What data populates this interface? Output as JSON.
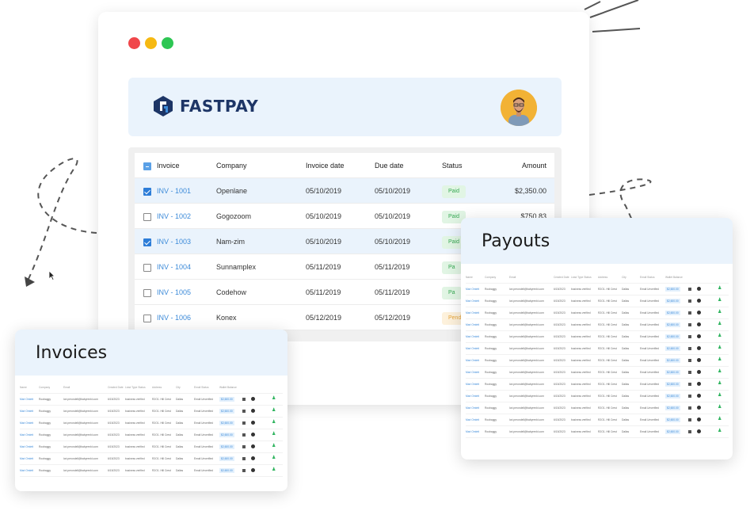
{
  "window": {
    "controls": [
      "close",
      "minimize",
      "maximize"
    ]
  },
  "brand": {
    "name": "FASTPAY",
    "logo_icon": "fastpay-logo-icon",
    "color": "#1d3566"
  },
  "user": {
    "avatar_icon": "user-avatar"
  },
  "invoice_table": {
    "headers": {
      "invoice": "Invoice",
      "company": "Company",
      "invoice_date": "Invoice date",
      "due_date": "Due date",
      "status": "Status",
      "amount": "Amount"
    },
    "rows": [
      {
        "id": "INV - 1001",
        "company": "Openlane",
        "invoice_date": "05/10/2019",
        "due_date": "05/10/2019",
        "status": "Paid",
        "amount": "$2,350.00",
        "checked": true
      },
      {
        "id": "INV - 1002",
        "company": "Gogozoom",
        "invoice_date": "05/10/2019",
        "due_date": "05/10/2019",
        "status": "Paid",
        "amount": "$750.83",
        "checked": false
      },
      {
        "id": "INV - 1003",
        "company": "Nam-zim",
        "invoice_date": "05/10/2019",
        "due_date": "05/10/2019",
        "status": "Paid",
        "amount": "",
        "checked": true
      },
      {
        "id": "INV - 1004",
        "company": "Sunnamplex",
        "invoice_date": "05/11/2019",
        "due_date": "05/11/2019",
        "status": "Pa",
        "amount": "",
        "checked": false
      },
      {
        "id": "INV - 1005",
        "company": "Codehow",
        "invoice_date": "05/11/2019",
        "due_date": "05/11/2019",
        "status": "Pa",
        "amount": "",
        "checked": false
      },
      {
        "id": "INV - 1006",
        "company": "Konex",
        "invoice_date": "05/12/2019",
        "due_date": "05/12/2019",
        "status": "Pend",
        "amount": "",
        "checked": false
      }
    ]
  },
  "invoices_panel": {
    "title": "Invoices",
    "headers": [
      "Name",
      "Company",
      "Email",
      "Created Date",
      "Lead Type Status",
      "Address",
      "City",
      "Email Status",
      "Wallet Balance"
    ],
    "row": {
      "name": "Mari Omlett",
      "company": "Roobaggy",
      "email": "lori.perondell@babyrenkt.com",
      "date": "6/15/2023",
      "status": "business verified",
      "address": "R2O1. Hill Crest",
      "city": "Dallas",
      "email_status": "Email Unverified",
      "balance": "$2,600.00"
    },
    "row_count": 7
  },
  "payouts_panel": {
    "title": "Payouts",
    "headers": [
      "Name",
      "Company",
      "Email",
      "Created Date",
      "Lead Type Status",
      "Address",
      "City",
      "Email Status",
      "Wallet Balance"
    ],
    "row": {
      "name": "Mari Omlett",
      "company": "Roobaggy",
      "email": "lori.perondell@babyrenkt.com",
      "date": "6/15/2023",
      "status": "business verified",
      "address": "R2O1. Hill Crest",
      "city": "Dallas",
      "email_status": "Email Unverified",
      "balance": "$2,600.00"
    },
    "row_count": 13
  },
  "colors": {
    "accent": "#3d8bd9",
    "header_bg": "#eaf3fc",
    "paid_bg": "#e1f5e4",
    "paid_text": "#36a852",
    "pending_bg": "#fdf1dc",
    "pending_text": "#e7a53a"
  }
}
